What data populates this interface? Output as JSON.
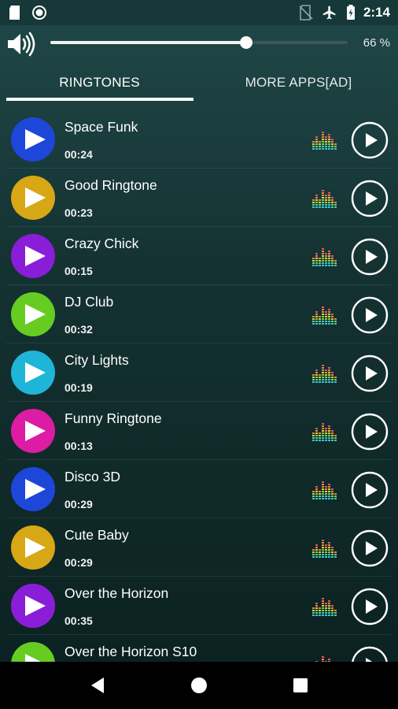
{
  "statusbar": {
    "time": "2:14",
    "icons": [
      "sd-card-icon",
      "record-icon",
      "no-sim-icon",
      "airplane-icon",
      "battery-charging-icon"
    ]
  },
  "volume": {
    "icon": "speaker-icon",
    "level": 0.66,
    "label": "66 %"
  },
  "tabs": [
    {
      "label": "RINGTONES",
      "active": true
    },
    {
      "label": "MORE APPS[AD]",
      "active": false
    }
  ],
  "ringtones": [
    {
      "title": "Space Funk",
      "duration": "00:24",
      "color": "#1c47d9"
    },
    {
      "title": "Good Ringtone",
      "duration": "00:23",
      "color": "#d8a716"
    },
    {
      "title": "Crazy Chick",
      "duration": "00:15",
      "color": "#8a1ed8"
    },
    {
      "title": "DJ Club",
      "duration": "00:32",
      "color": "#66cc22"
    },
    {
      "title": "City Lights",
      "duration": "00:19",
      "color": "#1fb5d8"
    },
    {
      "title": "Funny Ringtone",
      "duration": "00:13",
      "color": "#dc1ca3"
    },
    {
      "title": "Disco 3D",
      "duration": "00:29",
      "color": "#1c47d9"
    },
    {
      "title": "Cute Baby",
      "duration": "00:29",
      "color": "#d8a716"
    },
    {
      "title": "Over the Horizon",
      "duration": "00:35",
      "color": "#8a1ed8"
    },
    {
      "title": "Over the Horizon S10",
      "duration": "",
      "color": "#66cc22"
    }
  ],
  "navbar": {
    "icons": [
      "back-icon",
      "home-icon",
      "recents-icon"
    ]
  },
  "colors": {
    "background": "#143131",
    "accent": "#ffffff"
  }
}
